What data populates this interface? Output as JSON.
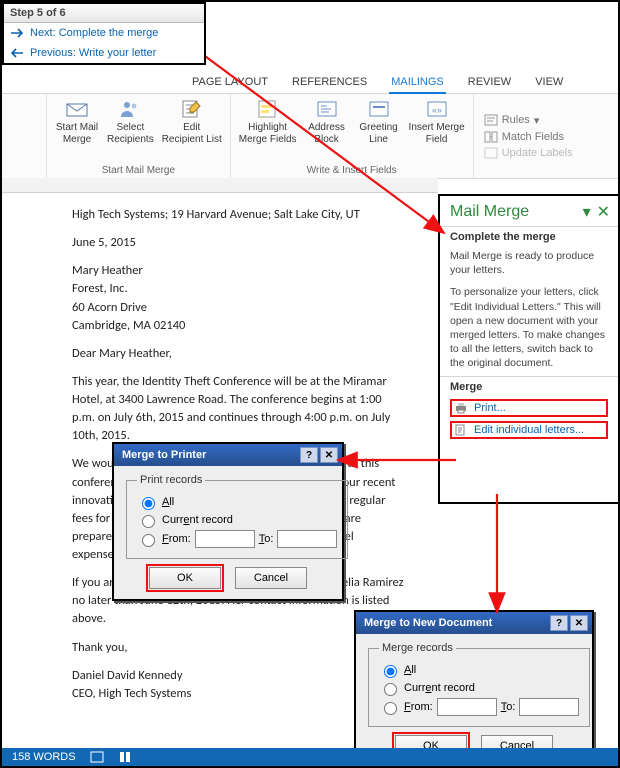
{
  "step": {
    "title": "Step 5 of 6",
    "next": "Next: Complete the merge",
    "prev": "Previous: Write your letter"
  },
  "tabs": {
    "page_layout": "PAGE LAYOUT",
    "references": "REFERENCES",
    "mailings": "MAILINGS",
    "review": "REVIEW",
    "view": "VIEW"
  },
  "ribbon": {
    "start_mail_merge": "Start Mail\nMerge",
    "select_recipients": "Select\nRecipients",
    "edit_recipient": "Edit\nRecipient List",
    "group1": "Start Mail Merge",
    "highlight": "Highlight\nMerge Fields",
    "address_block": "Address\nBlock",
    "greeting_line": "Greeting\nLine",
    "insert_merge_field": "Insert Merge\nField",
    "group2": "Write & Insert Fields",
    "rules": "Rules",
    "match_fields": "Match Fields",
    "update_labels": "Update Labels"
  },
  "document": {
    "header_line": "High Tech Systems; 19 Harvard Avenue; Salt Lake City, UT",
    "date": "June 5, 2015",
    "addr1": "Mary Heather",
    "addr2": "Forest, Inc.",
    "addr3": "60 Acorn Drive",
    "addr4": "Cambridge, MA 02140",
    "greeting": "Dear Mary Heather,",
    "p1": "This year, the Identity Theft Conference will be at the Miramar Hotel, at 3400 Lawrence Road. The conference begins at 1:00 p.m. on July 6th, 2015 and continues through 4:00 p.m. on July 10th, 2015.",
    "p2": "We would like to invite you to participate as a speaker at this conference. We understand your busy schedule and your recent innovations in Identity Theft are of great interest. Your regular fees for speaking engagements are approved, and we are prepared to offer you a 10% increase including all travel expenses.",
    "p3": "If you are interested in participating, please contact Celia Ramirez no later than June 12th, 2015. Her contact information is listed above.",
    "thanks": "Thank you,",
    "sig1": "Daniel David Kennedy",
    "sig2": "CEO, High Tech Systems"
  },
  "pane": {
    "title": "Mail Merge",
    "section1": "Complete the merge",
    "text1": "Mail Merge is ready to produce your letters.",
    "text2": "To personalize your letters, click \"Edit Individual Letters.\" This will open a new document with your merged letters. To make changes to all the letters, switch back to the original document.",
    "section2": "Merge",
    "print": "Print...",
    "edit_individual": "Edit individual letters..."
  },
  "dlg_printer": {
    "title": "Merge to Printer",
    "legend": "Print records",
    "opt_all": "All",
    "opt_current": "Current record",
    "opt_from": "From:",
    "to": "To:",
    "ok": "OK",
    "cancel": "Cancel"
  },
  "dlg_newdoc": {
    "title": "Merge to New Document",
    "legend": "Merge records",
    "opt_all": "All",
    "opt_current": "Current record",
    "opt_from": "From:",
    "to": "To:",
    "ok": "OK",
    "cancel": "Cancel"
  },
  "status": {
    "words": "158 WORDS"
  }
}
